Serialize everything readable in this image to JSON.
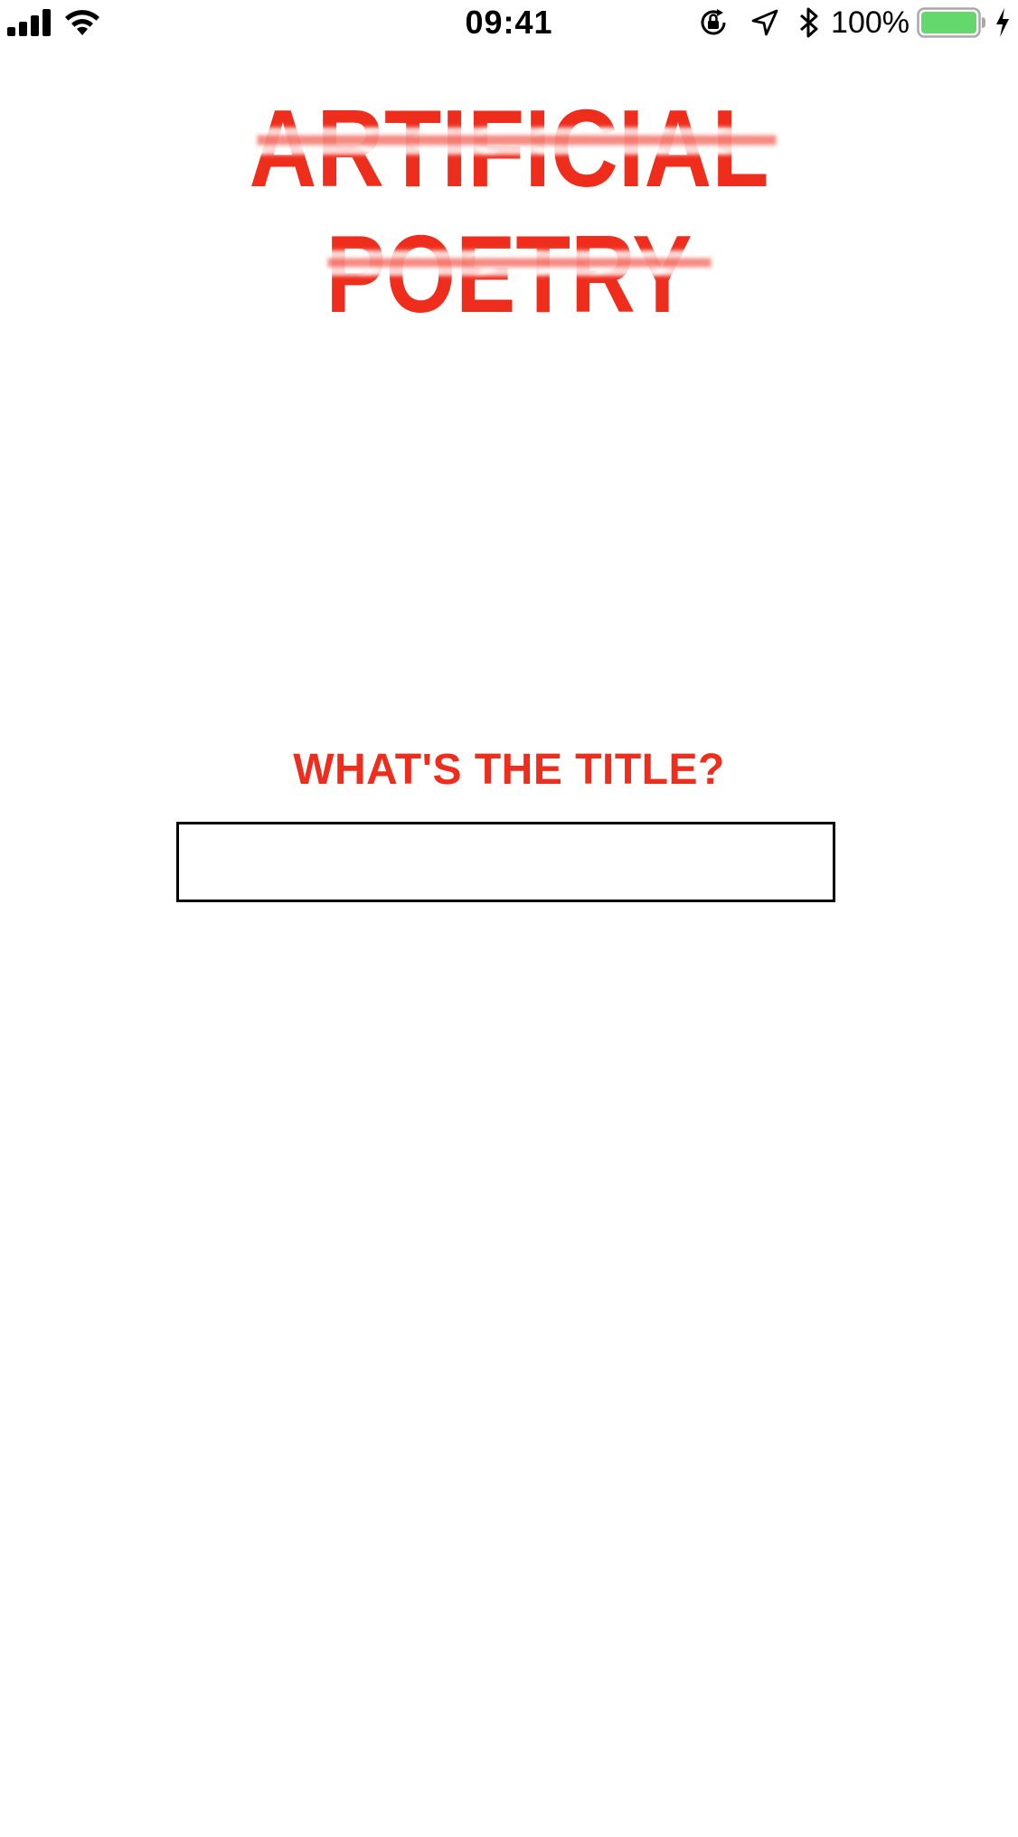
{
  "status_bar": {
    "time": "09:41",
    "battery_percent": "100%",
    "battery_level": 1.0,
    "battery_color": "#65d86d",
    "icons": [
      "signal-icon",
      "wifi-icon",
      "orientation-lock-icon",
      "location-arrow-icon",
      "bluetooth-icon",
      "battery-icon",
      "charging-bolt-icon"
    ]
  },
  "logo": {
    "line1": "ARTIFICIAL",
    "line2": "POETRY",
    "color": "#ef2d1d"
  },
  "prompt": {
    "heading": "WHAT'S THE TITLE?",
    "input_value": "",
    "input_placeholder": ""
  }
}
